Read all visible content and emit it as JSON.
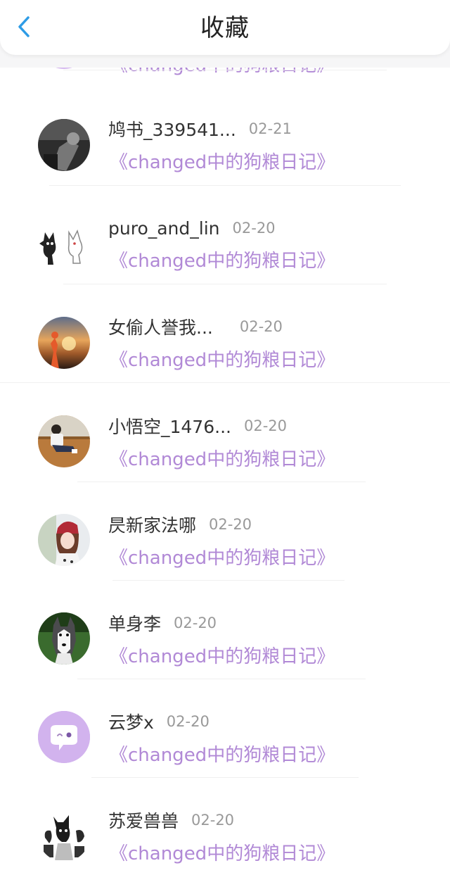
{
  "header": {
    "title": "收藏",
    "back_icon": "chevron-left-icon",
    "accent": "#2e9ce6"
  },
  "colors": {
    "work_title": "#b189d6",
    "username": "#333333",
    "date": "#999999"
  },
  "partial_row": {
    "work_title": "《changed中的狗粮日记》"
  },
  "rows": [
    {
      "username": "鸠书_339541...",
      "date": "02-21",
      "work_title": "《changed中的狗粮日记》",
      "avatar": "avatar-photo-dark"
    },
    {
      "username": "puro_and_lin",
      "date": "02-20",
      "work_title": "《changed中的狗粮日记》",
      "avatar": "avatar-cartoon-cats"
    },
    {
      "username": "女偷人誉我...",
      "date": "02-20",
      "work_title": "《changed中的狗粮日记》",
      "avatar": "avatar-sunset-runner"
    },
    {
      "username": "小悟空_1476...",
      "date": "02-20",
      "work_title": "《changed中的狗粮日记》",
      "avatar": "avatar-person-sitting"
    },
    {
      "username": "昃新家法哪",
      "date": "02-20",
      "work_title": "《changed中的狗粮日记》",
      "avatar": "avatar-girl-red-hat"
    },
    {
      "username": "单身李",
      "date": "02-20",
      "work_title": "《changed中的狗粮日记》",
      "avatar": "avatar-husky-dog"
    },
    {
      "username": "云梦x",
      "date": "02-20",
      "work_title": "《changed中的狗粮日记》",
      "avatar": "avatar-default-chat"
    },
    {
      "username": "苏爱兽兽",
      "date": "02-20",
      "work_title": "《changed中的狗粮日记》",
      "avatar": "avatar-sketch-creatures"
    }
  ]
}
